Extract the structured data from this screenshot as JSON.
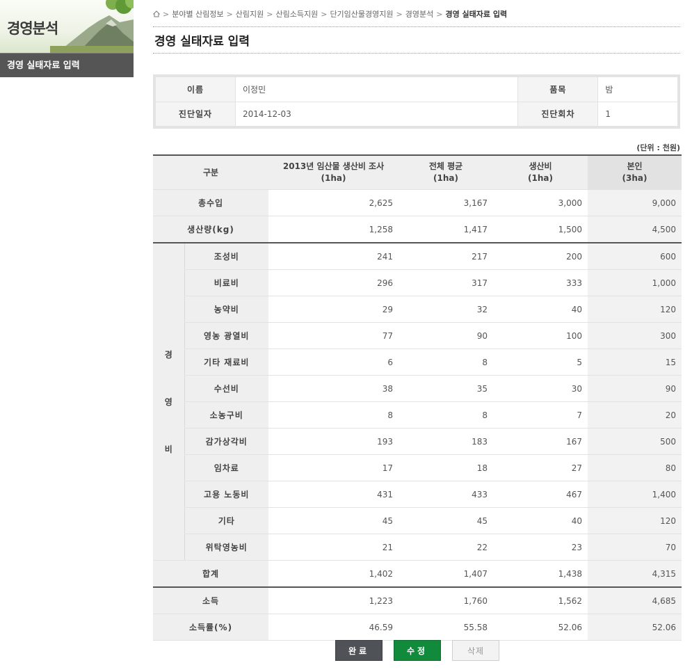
{
  "sidebar": {
    "title": "경영분석",
    "menu_item": "경영 실태자료 입력"
  },
  "breadcrumb": {
    "home_icon": "home-icon",
    "items": [
      "분야별 산림정보",
      "산림지원",
      "산림소득지원",
      "단기임산물경영지원",
      "경영분석"
    ],
    "current": "경영 실태자료 입력",
    "separator": ">"
  },
  "page_title": "경영 실태자료 입력",
  "info": {
    "name_label": "이름",
    "name_value": "이정민",
    "item_label": "품목",
    "item_value": "밤",
    "date_label": "진단일자",
    "date_value": "2014-12-03",
    "round_label": "진단회차",
    "round_value": "1"
  },
  "unit_note": "(단위 : 천원)",
  "table": {
    "headers": {
      "category": "구분",
      "survey": [
        "2013년 임산물 생산비 조사",
        "(1ha)"
      ],
      "average": [
        "전체 평균",
        "(1ha)"
      ],
      "cost": [
        "생산비",
        "(1ha)"
      ],
      "self": [
        "본인",
        "(3ha)"
      ]
    },
    "top_rows": [
      {
        "label": "총수입",
        "values": [
          "2,625",
          "3,167",
          "3,000",
          "9,000"
        ]
      },
      {
        "label": "생산량(kg)",
        "values": [
          "1,258",
          "1,417",
          "1,500",
          "4,500"
        ]
      }
    ],
    "expense_group": [
      "경",
      "영",
      "비"
    ],
    "expense_rows": [
      {
        "label": "조성비",
        "values": [
          "241",
          "217",
          "200",
          "600"
        ]
      },
      {
        "label": "비료비",
        "values": [
          "296",
          "317",
          "333",
          "1,000"
        ]
      },
      {
        "label": "농약비",
        "values": [
          "29",
          "32",
          "40",
          "120"
        ]
      },
      {
        "label": "영농 광열비",
        "values": [
          "77",
          "90",
          "100",
          "300"
        ]
      },
      {
        "label": "기타 재료비",
        "values": [
          "6",
          "8",
          "5",
          "15"
        ]
      },
      {
        "label": "수선비",
        "values": [
          "38",
          "35",
          "30",
          "90"
        ]
      },
      {
        "label": "소농구비",
        "values": [
          "8",
          "8",
          "7",
          "20"
        ]
      },
      {
        "label": "감가상각비",
        "values": [
          "193",
          "183",
          "167",
          "500"
        ]
      },
      {
        "label": "임차료",
        "values": [
          "17",
          "18",
          "27",
          "80"
        ]
      },
      {
        "label": "고용 노동비",
        "values": [
          "431",
          "433",
          "467",
          "1,400"
        ]
      },
      {
        "label": "기타",
        "values": [
          "45",
          "45",
          "40",
          "120"
        ]
      },
      {
        "label": "위탁영농비",
        "values": [
          "21",
          "22",
          "23",
          "70"
        ]
      }
    ],
    "total_row": {
      "label": "합계",
      "values": [
        "1,402",
        "1,407",
        "1,438",
        "4,315"
      ]
    },
    "bottom_rows": [
      {
        "label": "소득",
        "values": [
          "1,223",
          "1,760",
          "1,562",
          "4,685"
        ]
      },
      {
        "label": "소득률(%)",
        "values": [
          "46.59",
          "55.58",
          "52.06",
          "52.06"
        ]
      }
    ]
  },
  "buttons": {
    "done": "완료",
    "edit": "수정",
    "delete": "삭제"
  }
}
